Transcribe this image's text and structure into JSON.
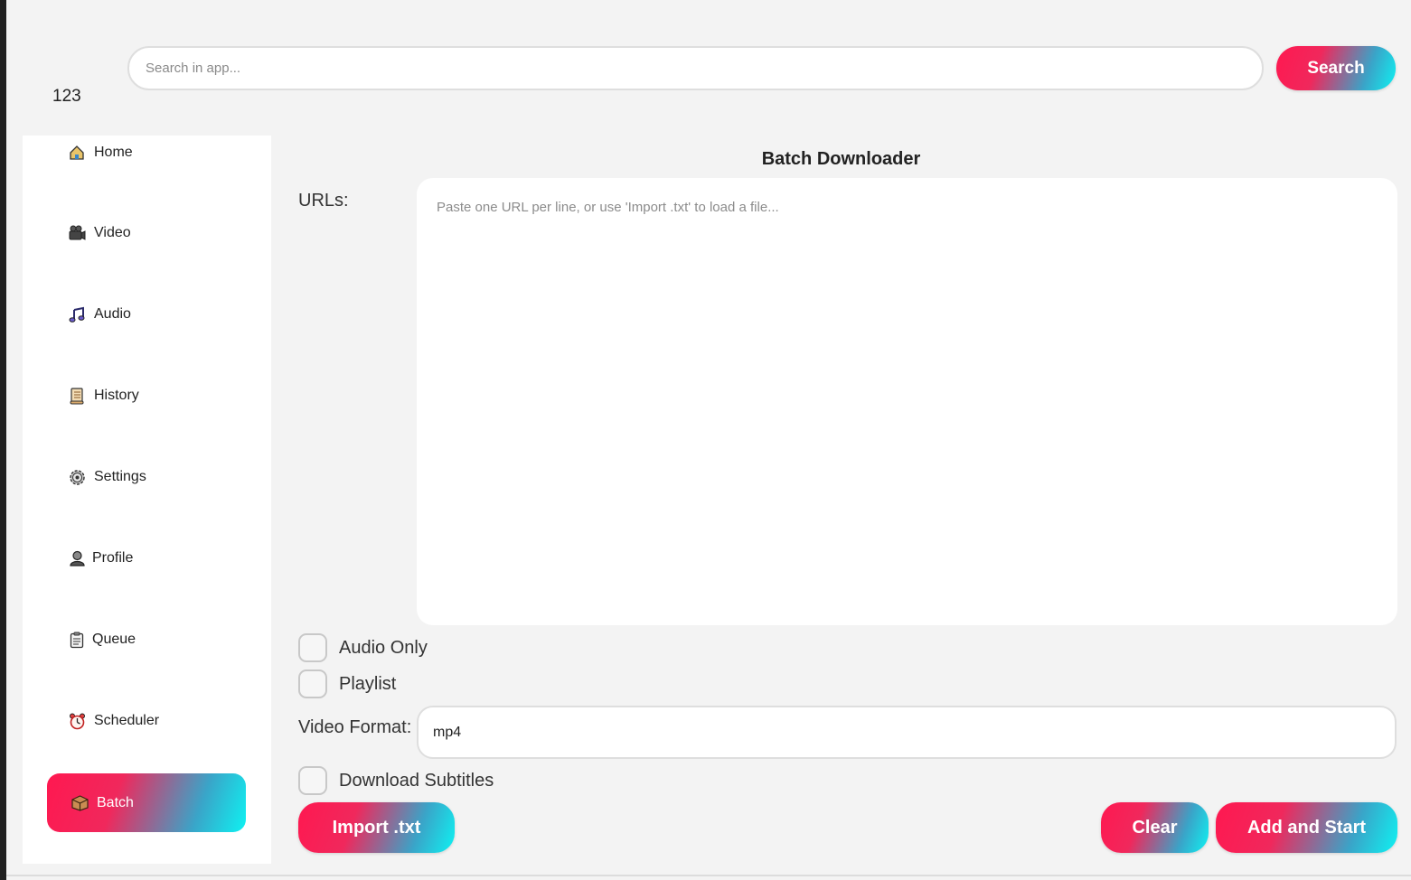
{
  "header": {
    "search_placeholder": "Search in app...",
    "search_label": "Search",
    "app_count": "123"
  },
  "sidebar": {
    "items": [
      {
        "label": "Home",
        "icon": "home-icon"
      },
      {
        "label": "Video",
        "icon": "film-camera-icon"
      },
      {
        "label": "Audio",
        "icon": "music-note-icon"
      },
      {
        "label": "History",
        "icon": "scroll-icon"
      },
      {
        "label": "Settings",
        "icon": "gear-icon"
      },
      {
        "label": "Profile",
        "icon": "person-icon"
      },
      {
        "label": "Queue",
        "icon": "clipboard-icon"
      },
      {
        "label": "Scheduler",
        "icon": "alarm-clock-icon"
      },
      {
        "label": "Batch",
        "icon": "box-icon",
        "active": true
      }
    ]
  },
  "main": {
    "title": "Batch Downloader",
    "urls_label": "URLs:",
    "urls_placeholder": "Paste one URL per line, or use 'Import .txt' to load a file...",
    "audio_only_label": "Audio Only",
    "playlist_label": "Playlist",
    "video_format_label": "Video Format:",
    "video_format_value": "mp4",
    "subtitles_label": "Download Subtitles",
    "import_label": "Import .txt",
    "clear_label": "Clear",
    "add_start_label": "Add and Start"
  },
  "colors": {
    "accent_start": "#ff1850",
    "accent_end": "#0ef2f2",
    "background": "#f3f3f3"
  }
}
